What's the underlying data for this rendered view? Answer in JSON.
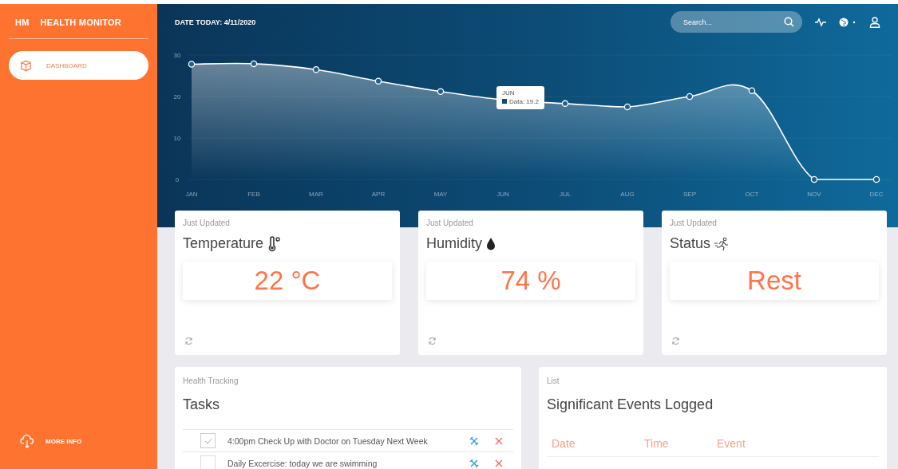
{
  "sidebar": {
    "logo": "HM",
    "title": "HEALTH MONITOR",
    "items": [
      {
        "label": "DASHBOARD",
        "selected": true
      }
    ],
    "footer_link": "MORE INFO"
  },
  "header": {
    "date": "DATE TODAY: 4/11/2020",
    "search": {
      "placeholder": "Search..."
    }
  },
  "chart": {
    "chart_data": {
      "type": "area",
      "categories": [
        "JAN",
        "FEB",
        "MAR",
        "APR",
        "MAY",
        "JUN",
        "JUL",
        "AUG",
        "SEP",
        "OCT",
        "NOV",
        "DEC"
      ],
      "series": [
        {
          "color": "#ffffff",
          "values": [
            27.8,
            27.9,
            26.5,
            23.7,
            21.2,
            19.2,
            18.3,
            17.5,
            20.0,
            21.4,
            0,
            0
          ]
        }
      ],
      "ylim": [
        0,
        30
      ],
      "yticks": [
        0,
        10,
        20,
        30
      ]
    },
    "tooltip": {
      "title": "JUN",
      "text": "Data: 19.2"
    }
  },
  "cards": [
    {
      "caption": "Just Updated",
      "title": "Temperature",
      "kind": "temperature",
      "value": "22 °C"
    },
    {
      "caption": "Just Updated",
      "title": "Humidity",
      "kind": "humidity",
      "value": "74 %"
    },
    {
      "caption": "Just Updated",
      "title": "Status",
      "kind": "status",
      "value": "Rest"
    }
  ],
  "tasks": {
    "caption": "Health Tracking",
    "title": "Tasks",
    "items": [
      {
        "text": "4:00pm Check Up with Doctor on Tuesday Next Week",
        "checked": true
      },
      {
        "text": "Daily Excercise: today we are swimming",
        "checked": false
      }
    ]
  },
  "events": {
    "caption": "List",
    "title": "Significant Events Logged",
    "columns": [
      "Date",
      "Time",
      "Event"
    ]
  }
}
